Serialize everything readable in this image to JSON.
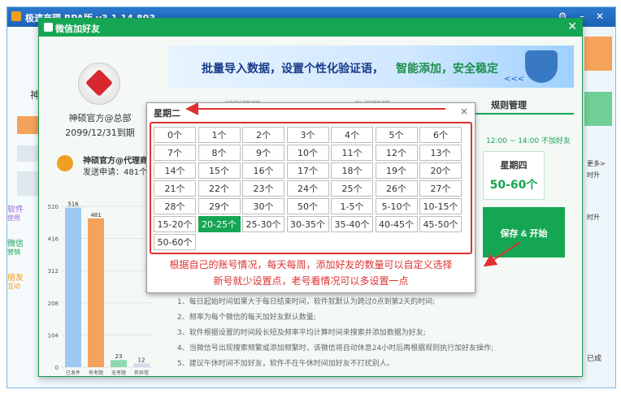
{
  "background_app": {
    "title": "极速产理 RPA版 v3.1.14.803",
    "left_items": [
      "神",
      "软件",
      "使用",
      "微信",
      "营销",
      "朋友",
      "互动"
    ],
    "right_items": [
      "更多>",
      "时升",
      "时升",
      "已成"
    ]
  },
  "dialog": {
    "title": "微信加好友",
    "account_name": "神硕官方@总部",
    "expiry": "2099/12/31到期",
    "agent_name": "神硕官方@代理商",
    "agent_sent": "发送申请：481个",
    "banner_text_main": "批量导入数据，设置个性化验证语，",
    "banner_text_accent": "智能添加，安全稳定",
    "banner_arrows": "<<<",
    "tabs": [
      "规则管理",
      "数据管理",
      "规则管理"
    ],
    "time_range": "12:00 ~ 14:00 不加好友",
    "day_card_title": "星期四",
    "day_card_value": "50-60个",
    "save_button": "保存 & 开始",
    "notes": [
      "1、每日起始时间如果大于每日结束时间，软件就默认为跨过0点到第2天的时间;",
      "2、频率为每个微信的每天加好友默认数量;",
      "3、软件根据设置的时间段长短及频率平均计算时间来搜索并添加数据为好友;",
      "4、当微信号出现搜索频繁或添加频繁时，该微信将自动休息24小时后再根据规则执行加好友操作;",
      "5、建议午休时间不加好友，软件不在午休时间加好友不打扰别人。"
    ]
  },
  "popup": {
    "title": "星期二",
    "close": "×",
    "options": [
      "0个",
      "1个",
      "2个",
      "3个",
      "4个",
      "5个",
      "6个",
      "7个",
      "8个",
      "9个",
      "10个",
      "11个",
      "12个",
      "13个",
      "14个",
      "15个",
      "16个",
      "17个",
      "18个",
      "19个",
      "20个",
      "21个",
      "22个",
      "23个",
      "24个",
      "25个",
      "26个",
      "27个",
      "28个",
      "29个",
      "30个",
      "50个",
      "1-5个",
      "5-10个",
      "10-15个",
      "15-20个",
      "20-25个",
      "25-30个",
      "30-35个",
      "35-40个",
      "40-45个",
      "45-50个",
      "50-60个"
    ],
    "selected": "20-25个",
    "note_line1": "根据自己的账号情况，每天每周，添加好友的数量可以自定义选择",
    "note_line2": "新号就少设置点，老号看情况可以多设置一点"
  },
  "chart_data": {
    "type": "bar",
    "categories": [
      "已发件",
      "有考题",
      "无考题",
      "有异常"
    ],
    "values": [
      516,
      481,
      23,
      12
    ],
    "yticks": [
      0,
      104,
      208,
      312,
      416,
      520
    ],
    "ylim": [
      0,
      520
    ],
    "colors": [
      "#9cc9f2",
      "#f5a25a",
      "#8ed8b0",
      "#d7d7ee"
    ]
  },
  "colors": {
    "accent": "#15a653",
    "highlight": "#e03030",
    "titlebar": "#1d62b4"
  }
}
